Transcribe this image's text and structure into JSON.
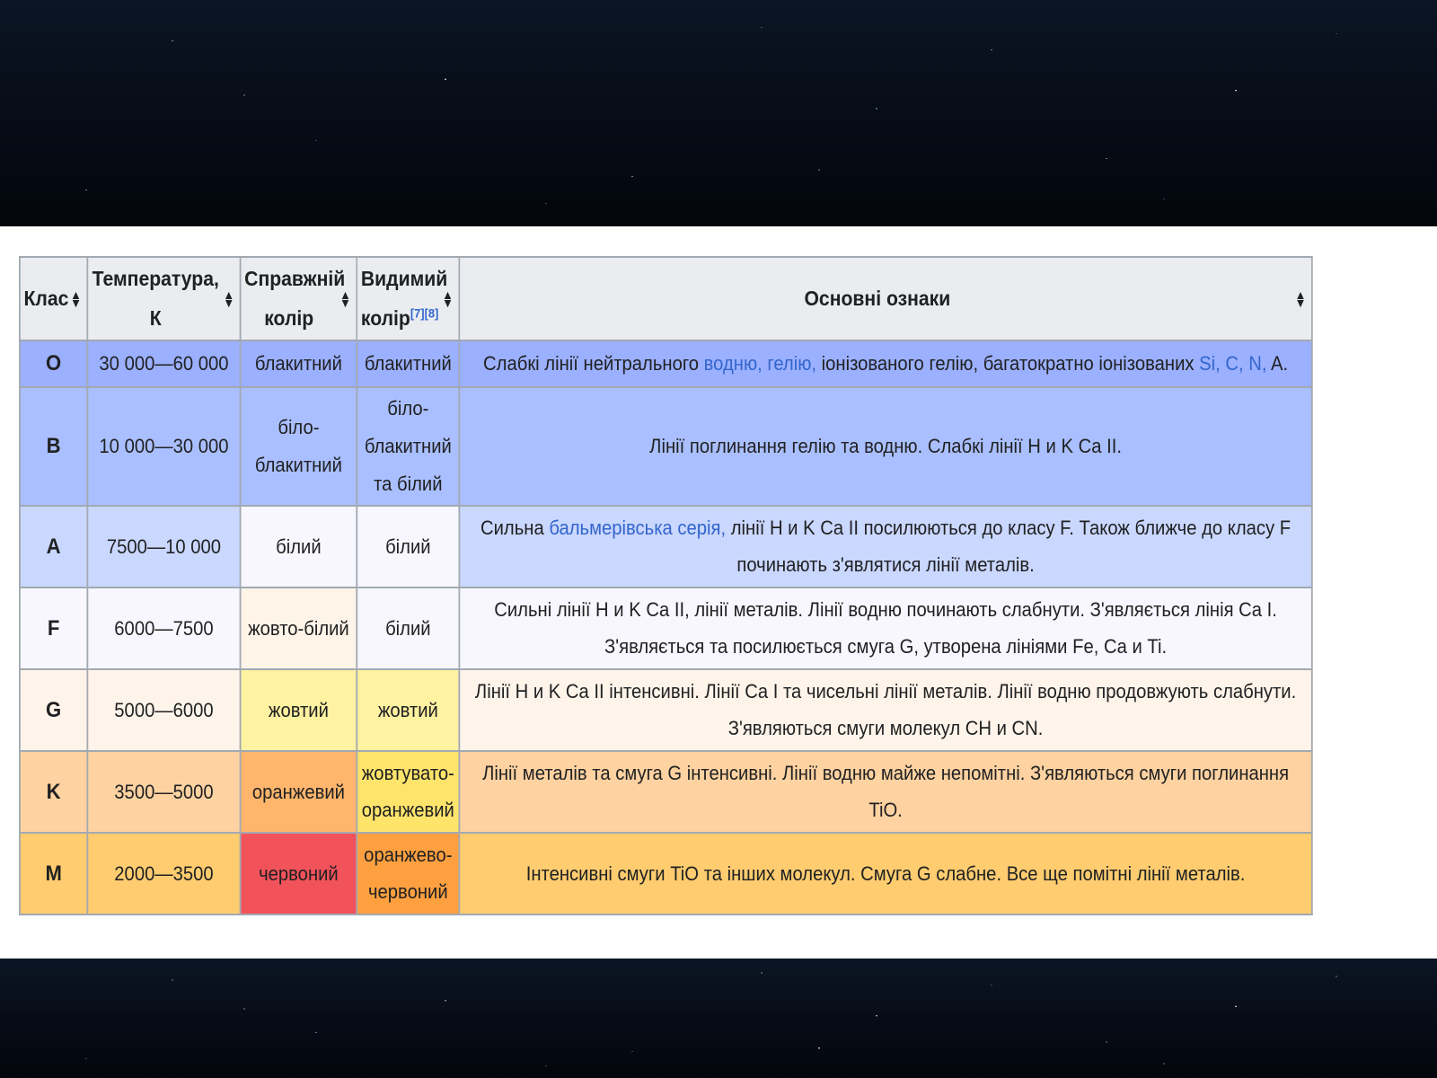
{
  "colors": {
    "header_bg": "#eaecf0",
    "border": "#a2a9b1",
    "link": "#3366cc",
    "O": "#9bb0ff",
    "B": "#aabfff",
    "A": "#cad7ff",
    "F": "#f8f7ff",
    "G": "#fff4ea",
    "K": "#ffd2a1",
    "M": "#ffcc6f",
    "true_color": {
      "blue": "#9bb0ff",
      "blue_white": "#aabfff",
      "white": "#f8f7ff",
      "yellow_white": "#fff4e8",
      "yellow": "#fff2a1",
      "orange": "#ffb56c",
      "red": "#f2525a"
    },
    "visible_color": {
      "yellow_orange": "#ffe46c",
      "orange_red": "#ffa040"
    }
  },
  "headers": {
    "class": "Клас",
    "temperature_line1": "Температура,",
    "temperature_line2": "К",
    "true_color_line1": "Справжній",
    "true_color_line2": "колір",
    "visible_color_line1": "Видимий",
    "visible_color_line2": "колір",
    "visible_color_refs": "[7][8]",
    "features": "Основні ознаки"
  },
  "rows": [
    {
      "class": "O",
      "temperature": "30 000—60 000",
      "true_color": "блакитний",
      "visible_color": "блакитний",
      "features_a": "Слабкі лінії нейтрального ",
      "features_link1": "водню, гелію,",
      "features_b": " іонізованого гелію, багатократно іонізованих ",
      "features_link2": "Si, C, N,",
      "features_c": " A."
    },
    {
      "class": "B",
      "temperature": "10 000—30 000",
      "true_color": "біло-блакитний",
      "visible_color": "біло-блакитний та білий",
      "features": "Лінії поглинання гелію та водню. Слабкі лінії H и K Ca II."
    },
    {
      "class": "A",
      "temperature": "7500—10 000",
      "true_color": "білий",
      "visible_color": "білий",
      "features_a": "Сильна ",
      "features_link1": "бальмерівська серія,",
      "features_b": " лінії H и K Ca II посилюються до класу F. Також ближче до класу F починають з'являтися лінії металів."
    },
    {
      "class": "F",
      "temperature": "6000—7500",
      "true_color": "жовто-білий",
      "visible_color": "білий",
      "features": "Сильні лінії H и K Ca II, лінії металів. Лінії водню починають слабнути. З'являється лінія Ca I. З'являється та посилюється смуга G, утворена лініями Fe, Ca и Ti."
    },
    {
      "class": "G",
      "temperature": "5000—6000",
      "true_color": "жовтий",
      "visible_color": "жовтий",
      "features": "Лінії H и K Ca II інтенсивні. Лінії Ca I та чисельні лінії металів. Лінії водню продовжують слабнути. З'являються смуги молекул CH и CN."
    },
    {
      "class": "K",
      "temperature": "3500—5000",
      "true_color": "оранжевий",
      "visible_color": "жовтувато-оранжевий",
      "features": "Лінії металів та смуга G інтенсивні. Лінії водню майже непомітні. З'являються смуги поглинання TiO."
    },
    {
      "class": "M",
      "temperature": "2000—3500",
      "true_color": "червоний",
      "visible_color": "оранжево-червоний",
      "features": "Інтенсивні смуги TiO та інших молекул. Смуга G слабне. Все ще помітні лінії металів."
    }
  ]
}
